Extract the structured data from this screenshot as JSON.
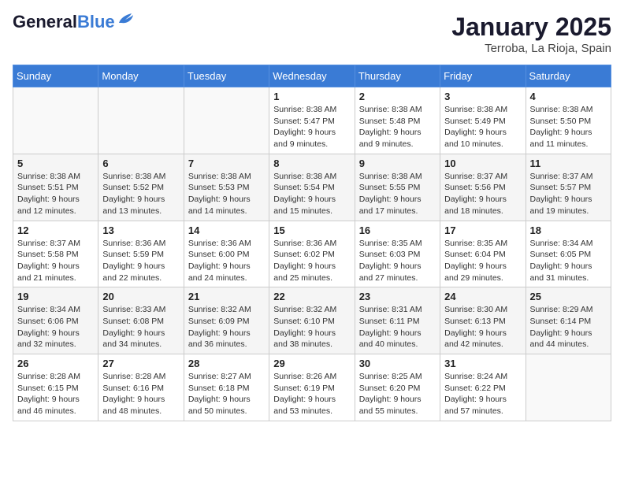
{
  "logo": {
    "part1": "General",
    "part2": "Blue"
  },
  "title": "January 2025",
  "subtitle": "Terroba, La Rioja, Spain",
  "weekdays": [
    "Sunday",
    "Monday",
    "Tuesday",
    "Wednesday",
    "Thursday",
    "Friday",
    "Saturday"
  ],
  "weeks": [
    [
      {
        "day": "",
        "info": ""
      },
      {
        "day": "",
        "info": ""
      },
      {
        "day": "",
        "info": ""
      },
      {
        "day": "1",
        "sunrise": "Sunrise: 8:38 AM",
        "sunset": "Sunset: 5:47 PM",
        "daylight": "Daylight: 9 hours and 9 minutes."
      },
      {
        "day": "2",
        "sunrise": "Sunrise: 8:38 AM",
        "sunset": "Sunset: 5:48 PM",
        "daylight": "Daylight: 9 hours and 9 minutes."
      },
      {
        "day": "3",
        "sunrise": "Sunrise: 8:38 AM",
        "sunset": "Sunset: 5:49 PM",
        "daylight": "Daylight: 9 hours and 10 minutes."
      },
      {
        "day": "4",
        "sunrise": "Sunrise: 8:38 AM",
        "sunset": "Sunset: 5:50 PM",
        "daylight": "Daylight: 9 hours and 11 minutes."
      }
    ],
    [
      {
        "day": "5",
        "sunrise": "Sunrise: 8:38 AM",
        "sunset": "Sunset: 5:51 PM",
        "daylight": "Daylight: 9 hours and 12 minutes."
      },
      {
        "day": "6",
        "sunrise": "Sunrise: 8:38 AM",
        "sunset": "Sunset: 5:52 PM",
        "daylight": "Daylight: 9 hours and 13 minutes."
      },
      {
        "day": "7",
        "sunrise": "Sunrise: 8:38 AM",
        "sunset": "Sunset: 5:53 PM",
        "daylight": "Daylight: 9 hours and 14 minutes."
      },
      {
        "day": "8",
        "sunrise": "Sunrise: 8:38 AM",
        "sunset": "Sunset: 5:54 PM",
        "daylight": "Daylight: 9 hours and 15 minutes."
      },
      {
        "day": "9",
        "sunrise": "Sunrise: 8:38 AM",
        "sunset": "Sunset: 5:55 PM",
        "daylight": "Daylight: 9 hours and 17 minutes."
      },
      {
        "day": "10",
        "sunrise": "Sunrise: 8:37 AM",
        "sunset": "Sunset: 5:56 PM",
        "daylight": "Daylight: 9 hours and 18 minutes."
      },
      {
        "day": "11",
        "sunrise": "Sunrise: 8:37 AM",
        "sunset": "Sunset: 5:57 PM",
        "daylight": "Daylight: 9 hours and 19 minutes."
      }
    ],
    [
      {
        "day": "12",
        "sunrise": "Sunrise: 8:37 AM",
        "sunset": "Sunset: 5:58 PM",
        "daylight": "Daylight: 9 hours and 21 minutes."
      },
      {
        "day": "13",
        "sunrise": "Sunrise: 8:36 AM",
        "sunset": "Sunset: 5:59 PM",
        "daylight": "Daylight: 9 hours and 22 minutes."
      },
      {
        "day": "14",
        "sunrise": "Sunrise: 8:36 AM",
        "sunset": "Sunset: 6:00 PM",
        "daylight": "Daylight: 9 hours and 24 minutes."
      },
      {
        "day": "15",
        "sunrise": "Sunrise: 8:36 AM",
        "sunset": "Sunset: 6:02 PM",
        "daylight": "Daylight: 9 hours and 25 minutes."
      },
      {
        "day": "16",
        "sunrise": "Sunrise: 8:35 AM",
        "sunset": "Sunset: 6:03 PM",
        "daylight": "Daylight: 9 hours and 27 minutes."
      },
      {
        "day": "17",
        "sunrise": "Sunrise: 8:35 AM",
        "sunset": "Sunset: 6:04 PM",
        "daylight": "Daylight: 9 hours and 29 minutes."
      },
      {
        "day": "18",
        "sunrise": "Sunrise: 8:34 AM",
        "sunset": "Sunset: 6:05 PM",
        "daylight": "Daylight: 9 hours and 31 minutes."
      }
    ],
    [
      {
        "day": "19",
        "sunrise": "Sunrise: 8:34 AM",
        "sunset": "Sunset: 6:06 PM",
        "daylight": "Daylight: 9 hours and 32 minutes."
      },
      {
        "day": "20",
        "sunrise": "Sunrise: 8:33 AM",
        "sunset": "Sunset: 6:08 PM",
        "daylight": "Daylight: 9 hours and 34 minutes."
      },
      {
        "day": "21",
        "sunrise": "Sunrise: 8:32 AM",
        "sunset": "Sunset: 6:09 PM",
        "daylight": "Daylight: 9 hours and 36 minutes."
      },
      {
        "day": "22",
        "sunrise": "Sunrise: 8:32 AM",
        "sunset": "Sunset: 6:10 PM",
        "daylight": "Daylight: 9 hours and 38 minutes."
      },
      {
        "day": "23",
        "sunrise": "Sunrise: 8:31 AM",
        "sunset": "Sunset: 6:11 PM",
        "daylight": "Daylight: 9 hours and 40 minutes."
      },
      {
        "day": "24",
        "sunrise": "Sunrise: 8:30 AM",
        "sunset": "Sunset: 6:13 PM",
        "daylight": "Daylight: 9 hours and 42 minutes."
      },
      {
        "day": "25",
        "sunrise": "Sunrise: 8:29 AM",
        "sunset": "Sunset: 6:14 PM",
        "daylight": "Daylight: 9 hours and 44 minutes."
      }
    ],
    [
      {
        "day": "26",
        "sunrise": "Sunrise: 8:28 AM",
        "sunset": "Sunset: 6:15 PM",
        "daylight": "Daylight: 9 hours and 46 minutes."
      },
      {
        "day": "27",
        "sunrise": "Sunrise: 8:28 AM",
        "sunset": "Sunset: 6:16 PM",
        "daylight": "Daylight: 9 hours and 48 minutes."
      },
      {
        "day": "28",
        "sunrise": "Sunrise: 8:27 AM",
        "sunset": "Sunset: 6:18 PM",
        "daylight": "Daylight: 9 hours and 50 minutes."
      },
      {
        "day": "29",
        "sunrise": "Sunrise: 8:26 AM",
        "sunset": "Sunset: 6:19 PM",
        "daylight": "Daylight: 9 hours and 53 minutes."
      },
      {
        "day": "30",
        "sunrise": "Sunrise: 8:25 AM",
        "sunset": "Sunset: 6:20 PM",
        "daylight": "Daylight: 9 hours and 55 minutes."
      },
      {
        "day": "31",
        "sunrise": "Sunrise: 8:24 AM",
        "sunset": "Sunset: 6:22 PM",
        "daylight": "Daylight: 9 hours and 57 minutes."
      },
      {
        "day": "",
        "info": ""
      }
    ]
  ]
}
